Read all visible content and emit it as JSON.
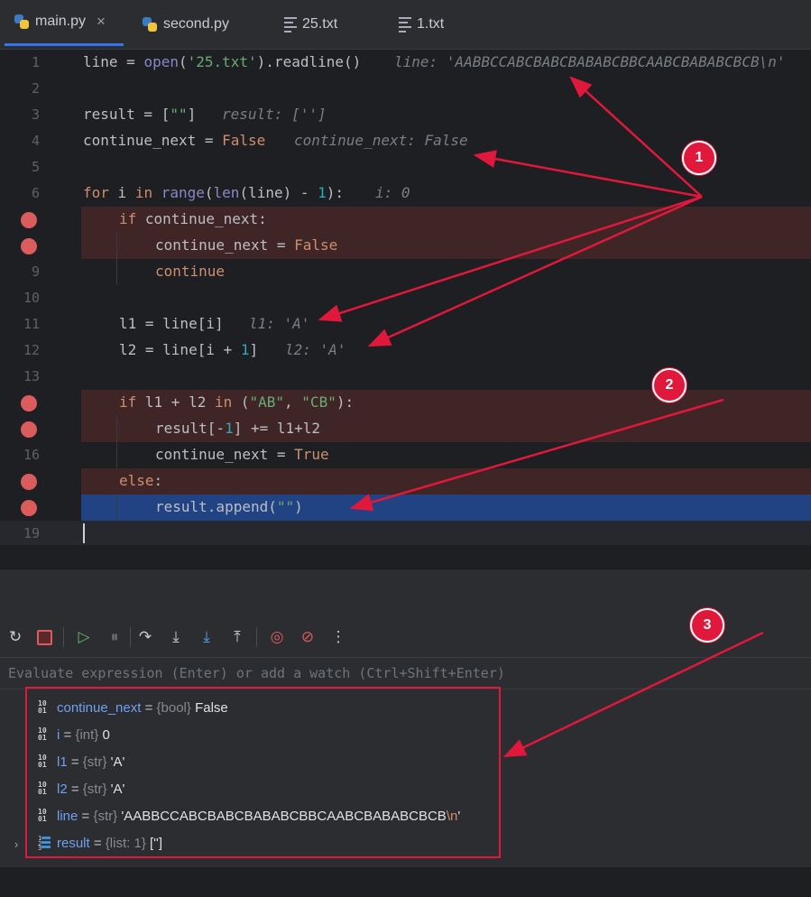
{
  "tabs": [
    {
      "label": "main.py",
      "icon": "python-file-icon",
      "active": true,
      "close": "×"
    },
    {
      "label": "second.py",
      "icon": "python-file-icon",
      "active": false
    },
    {
      "label": "25.txt",
      "icon": "text-file-icon",
      "active": false
    },
    {
      "label": "1.txt",
      "icon": "text-file-icon",
      "active": false
    }
  ],
  "editor": {
    "line_numbers": [
      "1",
      "2",
      "3",
      "4",
      "5",
      "6",
      "9",
      "10",
      "11",
      "12",
      "13",
      "16",
      "19"
    ],
    "l1": {
      "code": "line = open('25.txt').readline()",
      "hint": "line: 'AABBCCABCBABCBABABCBBCAABCBABABCBCB\\n'"
    },
    "l3": {
      "hint": "result: ['']"
    },
    "l4": {
      "hint": "continue_next: False"
    },
    "l6": {
      "hint": "i: 0"
    },
    "l11": {
      "hint": "l1: 'A'"
    },
    "l12": {
      "hint": "l2: 'A'"
    }
  },
  "evaluate_placeholder": "Evaluate expression (Enter) or add a watch (Ctrl+Shift+Enter)",
  "variables": [
    {
      "name": "continue_next",
      "type": "{bool}",
      "value": "False"
    },
    {
      "name": "i",
      "type": "{int}",
      "value": "0"
    },
    {
      "name": "l1",
      "type": "{str}",
      "value": "'A'"
    },
    {
      "name": "l2",
      "type": "{str}",
      "value": "'A'"
    },
    {
      "name": "line",
      "type": "{str}",
      "value": "'AABBCCABCBABCBABABCBBCAABCBABABCBCB",
      "escape": "\\n",
      "value_end": "'"
    },
    {
      "name": "result",
      "type": "{list: 1}",
      "value": "['']"
    }
  ],
  "annotations": {
    "badge1": "1",
    "badge2": "2",
    "badge3": "3"
  },
  "colors": {
    "accent": "#3574f0",
    "annotation_red": "#e0183c",
    "breakpoint": "#db5c5c"
  }
}
